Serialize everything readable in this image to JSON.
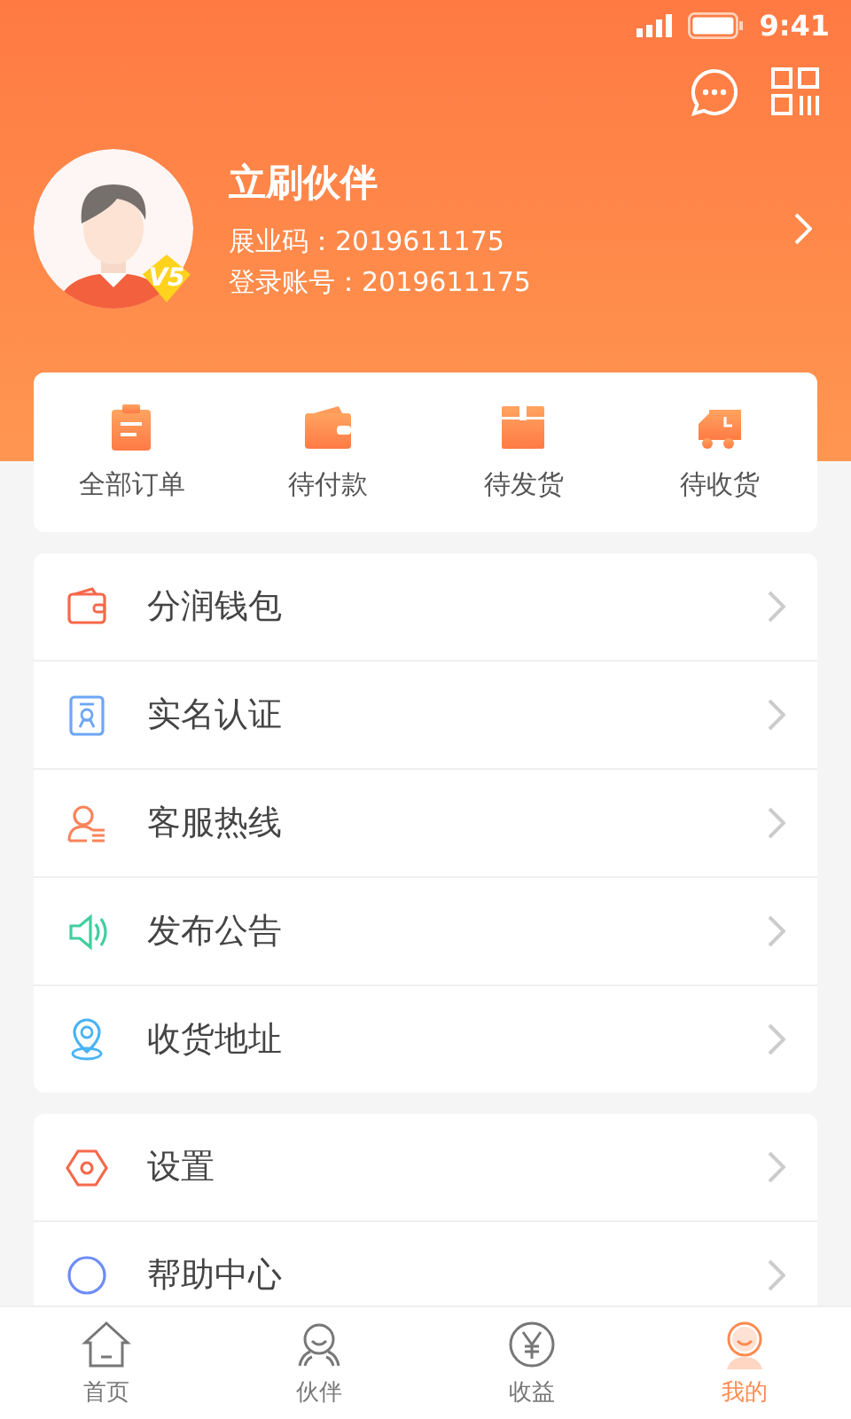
{
  "status_bar": {
    "time": "9:41"
  },
  "profile": {
    "name": "立刷伙伴",
    "level_badge": "V5",
    "lines": [
      "展业码：2019611175",
      "登录账号：2019611175"
    ]
  },
  "orders": [
    {
      "label": "全部订单"
    },
    {
      "label": "待付款"
    },
    {
      "label": "待发货"
    },
    {
      "label": "待收货"
    }
  ],
  "menu_groups": [
    [
      {
        "label": "分润钱包"
      },
      {
        "label": "实名认证"
      },
      {
        "label": "客服热线"
      },
      {
        "label": "发布公告"
      },
      {
        "label": "收货地址"
      }
    ],
    [
      {
        "label": "设置"
      },
      {
        "label": "帮助中心"
      }
    ]
  ],
  "tab_bar": [
    {
      "label": "首页",
      "selected": false
    },
    {
      "label": "伙伴",
      "selected": false
    },
    {
      "label": "收益",
      "selected": false
    },
    {
      "label": "我的",
      "selected": true
    }
  ]
}
